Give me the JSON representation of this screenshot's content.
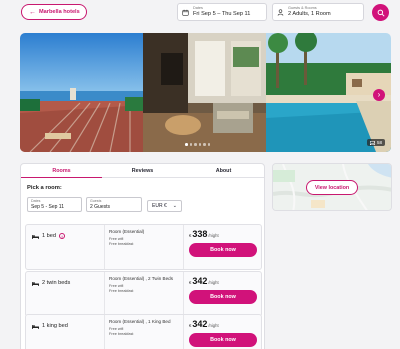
{
  "header": {
    "back_label": "Marbella hotels",
    "dates": {
      "label": "Dates",
      "value": "Fri Sep 5 – Thu Sep 11"
    },
    "guests": {
      "label": "Guests & Rooms",
      "value": "2 Adults, 1 Room"
    }
  },
  "gallery": {
    "photo_count": "58",
    "dots_total": 6,
    "dots_active": 1
  },
  "tabs": [
    {
      "label": "Rooms",
      "active": true
    },
    {
      "label": "Reviews",
      "active": false
    },
    {
      "label": "About",
      "active": false
    }
  ],
  "booking": {
    "pick_label": "Pick a room:",
    "dates": {
      "label": "Dates",
      "value": "Sep 5 - Sep 11"
    },
    "guests": {
      "label": "Guests",
      "value": "2 Guests"
    },
    "currency": "EUR €"
  },
  "rooms": [
    {
      "name": "1 bed",
      "type": "Room (Essential)",
      "perks": [
        "Free wifi",
        "Free breakfast"
      ],
      "currency": "€",
      "price": "338",
      "per": "/night",
      "book_label": "Book now"
    },
    {
      "name": "2 twin beds",
      "type": "Room (Essential) , 2 Twin Beds",
      "perks": [
        "Free wifi",
        "Free breakfast"
      ],
      "currency": "€",
      "price": "342",
      "per": "/night",
      "book_label": "Book now"
    },
    {
      "name": "1 king bed",
      "type": "Room (Essential) , 1 King Bed",
      "perks": [
        "Free wifi",
        "Free breakfast"
      ],
      "currency": "€",
      "price": "342",
      "per": "/night",
      "book_label": "Book now"
    }
  ],
  "map": {
    "button_label": "View location"
  },
  "colors": {
    "accent": "#d1127a",
    "accent_text": "#c8186f",
    "background": "#f3f3f5"
  }
}
